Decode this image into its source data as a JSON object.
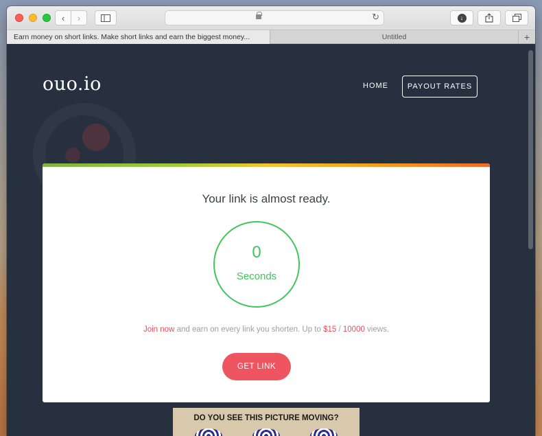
{
  "browser": {
    "tabs": [
      {
        "title": "Earn money on short links. Make short links and earn the biggest money..."
      },
      {
        "title": "Untitled"
      }
    ],
    "new_tab_label": "+"
  },
  "site": {
    "logo": "ouo.io",
    "nav": {
      "home": "HOME",
      "payout_rates": "PAYOUT RATES"
    }
  },
  "card": {
    "title": "Your link is almost ready.",
    "timer": {
      "value": "0",
      "label": "Seconds"
    },
    "promo": {
      "join": "Join now",
      "middle": " and earn on every link you shorten. Up to ",
      "amount": "$15",
      "slash": " / ",
      "views": "10000",
      "suffix": " views."
    },
    "button": "GET LINK"
  },
  "ad": {
    "text": "DO YOU SEE THIS PICTURE MOVING?"
  },
  "colors": {
    "page_bg": "#26303f",
    "accent_green": "#3fc65c",
    "accent_red": "#ee5560"
  }
}
